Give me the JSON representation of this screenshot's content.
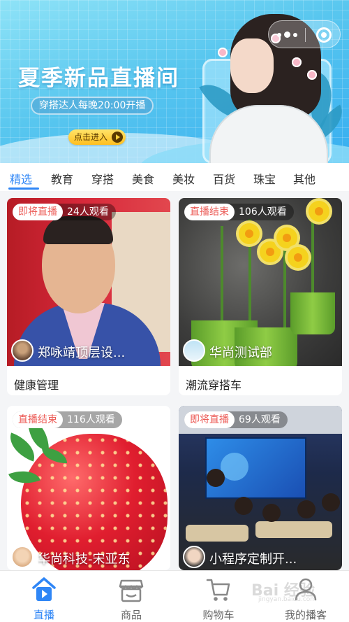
{
  "banner": {
    "title": "夏季新品直播间",
    "subtitle": "穿搭达人每晚20:00开播",
    "button_label": "点击进入"
  },
  "capsule": {
    "more_icon": "more-dots-icon",
    "close_icon": "target-circle-icon"
  },
  "tabs": [
    {
      "label": "精选",
      "active": true
    },
    {
      "label": "教育"
    },
    {
      "label": "穿搭"
    },
    {
      "label": "美食"
    },
    {
      "label": "美妆"
    },
    {
      "label": "百货"
    },
    {
      "label": "珠宝"
    },
    {
      "label": "其他"
    }
  ],
  "cards": [
    {
      "status": "即将直播",
      "viewers": "24人观看",
      "anchor": "郑咏靖顶层设...",
      "title": "健康管理"
    },
    {
      "status": "直播结束",
      "viewers": "106人观看",
      "anchor": "华尚测试部",
      "title": "潮流穿搭车"
    },
    {
      "status": "直播结束",
      "viewers": "116人观看",
      "anchor": "华尚科技-宋亚东",
      "title": ""
    },
    {
      "status": "即将直播",
      "viewers": "69人观看",
      "anchor": "小程序定制开...",
      "title": ""
    }
  ],
  "bottom_nav": [
    {
      "label": "直播",
      "icon": "live-house-icon",
      "active": true
    },
    {
      "label": "商品",
      "icon": "shop-icon"
    },
    {
      "label": "购物车",
      "icon": "cart-icon"
    },
    {
      "label": "我的播客",
      "icon": "user-icon"
    }
  ],
  "watermark": {
    "text": "Bai 经验",
    "sub": "jingyan.baidu.com"
  },
  "colors": {
    "accent": "#2f86f6",
    "status_text": "#ec5b56",
    "background": "#f4f5f7"
  }
}
